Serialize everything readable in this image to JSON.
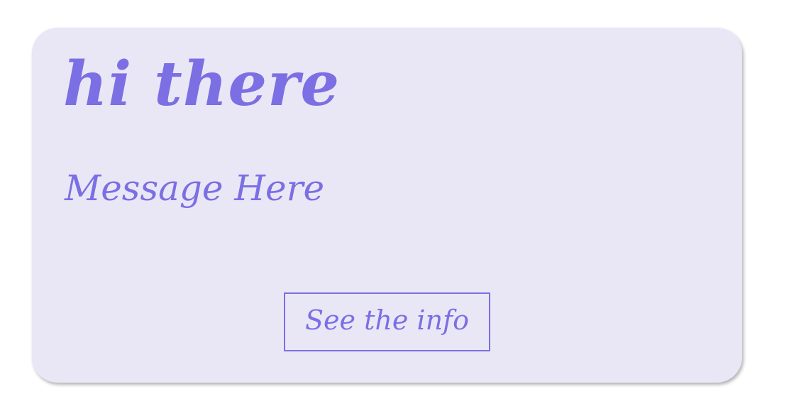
{
  "card": {
    "title": "hi there",
    "message": "Message Here",
    "button_label": "See the info"
  },
  "colors": {
    "accent": "#7b6fe3",
    "card_background": "#e9e7f6",
    "page_background": "#ffffff"
  }
}
